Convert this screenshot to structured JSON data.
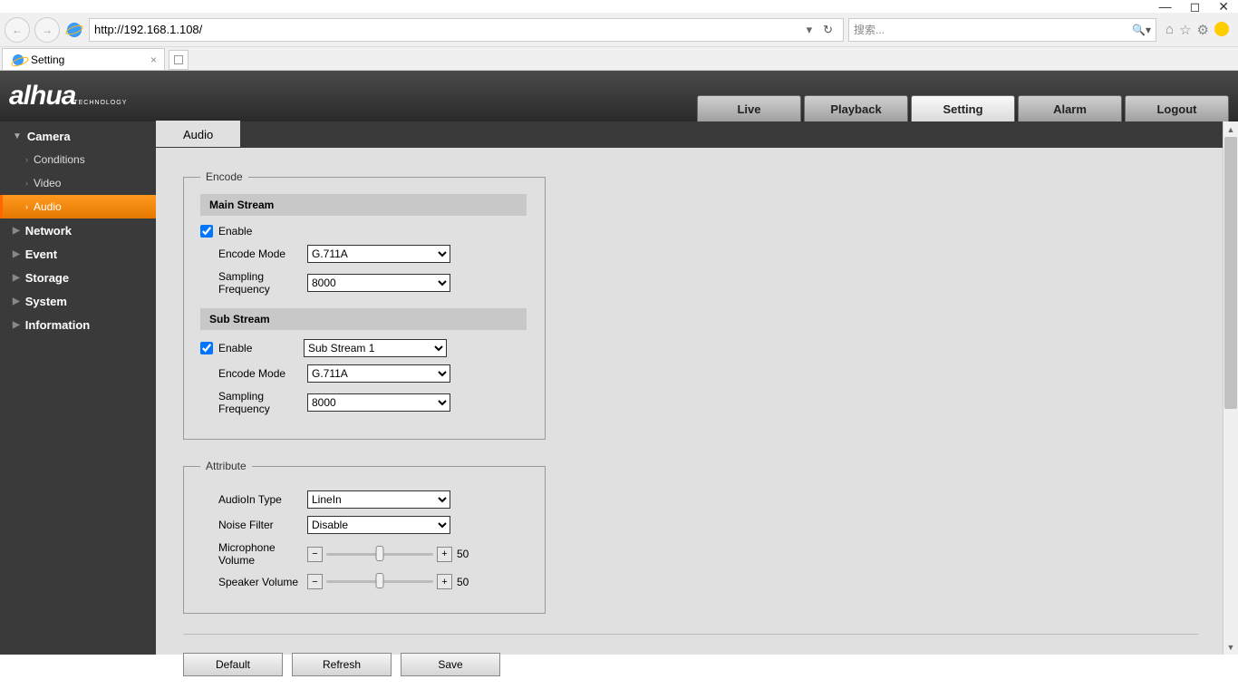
{
  "browser": {
    "url": "http://192.168.1.108/",
    "search_placeholder": "搜索...",
    "tab_title": "Setting"
  },
  "logo": {
    "main": "alhua",
    "sub": "TECHNOLOGY"
  },
  "mainNav": {
    "live": "Live",
    "playback": "Playback",
    "setting": "Setting",
    "alarm": "Alarm",
    "logout": "Logout"
  },
  "sidebar": {
    "camera": "Camera",
    "camera_items": {
      "conditions": "Conditions",
      "video": "Video",
      "audio": "Audio"
    },
    "network": "Network",
    "event": "Event",
    "storage": "Storage",
    "system": "System",
    "information": "Information"
  },
  "contentTab": "Audio",
  "encode": {
    "legend": "Encode",
    "main_stream_hdr": "Main Stream",
    "enable_label": "Enable",
    "encode_mode_label": "Encode Mode",
    "encode_mode_value": "G.711A",
    "sampling_label": "Sampling Frequency",
    "sampling_value": "8000",
    "sub_stream_hdr": "Sub Stream",
    "sub_enable_label": "Enable",
    "sub_stream_select": "Sub Stream 1",
    "sub_encode_mode_value": "G.711A",
    "sub_sampling_value": "8000"
  },
  "attribute": {
    "legend": "Attribute",
    "audioin_label": "AudioIn Type",
    "audioin_value": "LineIn",
    "noise_label": "Noise Filter",
    "noise_value": "Disable",
    "mic_label": "Microphone Volume",
    "mic_value": "50",
    "spk_label": "Speaker Volume",
    "spk_value": "50"
  },
  "buttons": {
    "default": "Default",
    "refresh": "Refresh",
    "save": "Save"
  }
}
